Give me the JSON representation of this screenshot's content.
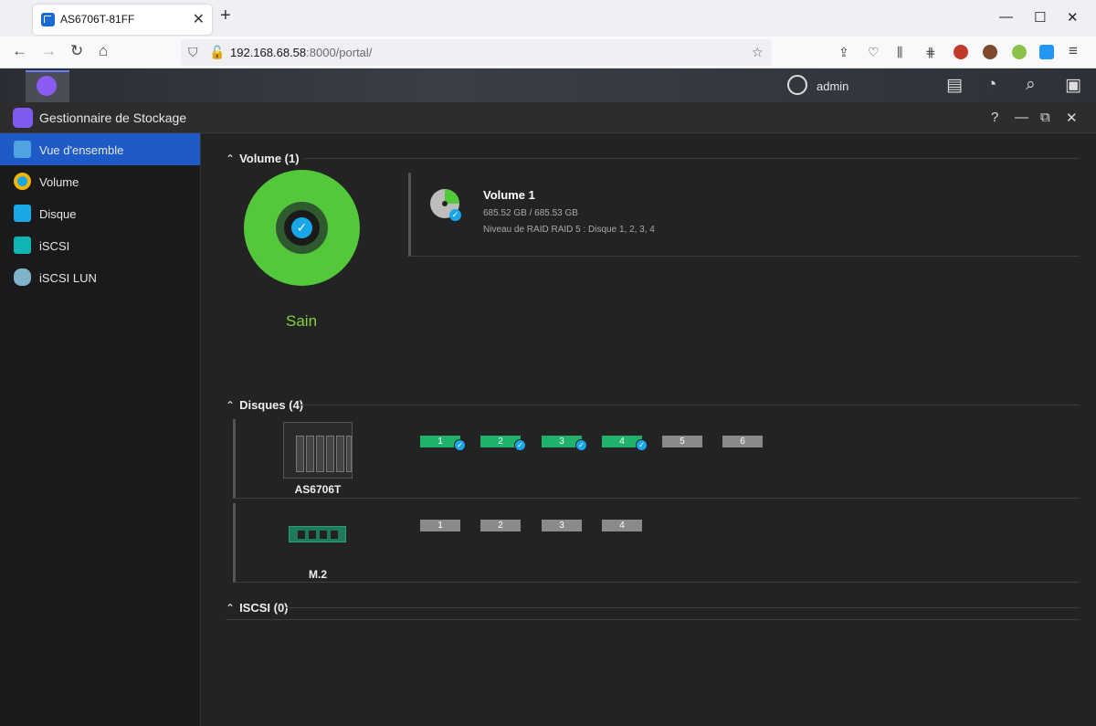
{
  "browser": {
    "tab_title": "AS6706T-81FF",
    "tab_close": "✕",
    "new_tab": "+",
    "url_host": "192.168.68.58",
    "url_rest": ":8000/portal/",
    "minimize": "—",
    "maximize": "☐",
    "close": "✕"
  },
  "topbar": {
    "user": "admin"
  },
  "window": {
    "title": "Gestionnaire de Stockage",
    "help": "?",
    "minimize": "—",
    "restore": "⧉",
    "close": "✕"
  },
  "sidebar": {
    "items": [
      {
        "label": "Vue d'ensemble",
        "icon": "overview-icon",
        "active": true
      },
      {
        "label": "Volume",
        "icon": "volume-icon"
      },
      {
        "label": "Disque",
        "icon": "disk-icon"
      },
      {
        "label": "iSCSI",
        "icon": "iscsi-icon"
      },
      {
        "label": "iSCSI LUN",
        "icon": "iscsi-lun-icon"
      }
    ]
  },
  "volume_section": {
    "title": "Volume (1)",
    "status": "Sain",
    "volume": {
      "name": "Volume 1",
      "size": "685.52 GB / 685.53 GB",
      "raid": "Niveau de RAID RAID 5 : Disque 1, 2, 3, 4"
    }
  },
  "disks_section": {
    "title": "Disques (4)",
    "devices": [
      {
        "name": "AS6706T",
        "slots": [
          {
            "label": "1",
            "state": "ok"
          },
          {
            "label": "2",
            "state": "ok"
          },
          {
            "label": "3",
            "state": "ok"
          },
          {
            "label": "4",
            "state": "ok"
          },
          {
            "label": "5",
            "state": "empty"
          },
          {
            "label": "6",
            "state": "empty"
          }
        ]
      },
      {
        "name": "M.2",
        "slots": [
          {
            "label": "1",
            "state": "empty"
          },
          {
            "label": "2",
            "state": "empty"
          },
          {
            "label": "3",
            "state": "empty"
          },
          {
            "label": "4",
            "state": "empty"
          }
        ]
      }
    ]
  },
  "iscsi_section": {
    "title": "ISCSI (0)"
  },
  "colors": {
    "accent": "#1e5bc6",
    "healthy": "#52c83a",
    "disk_ok": "#20b26b",
    "check": "#1aa7e8"
  }
}
